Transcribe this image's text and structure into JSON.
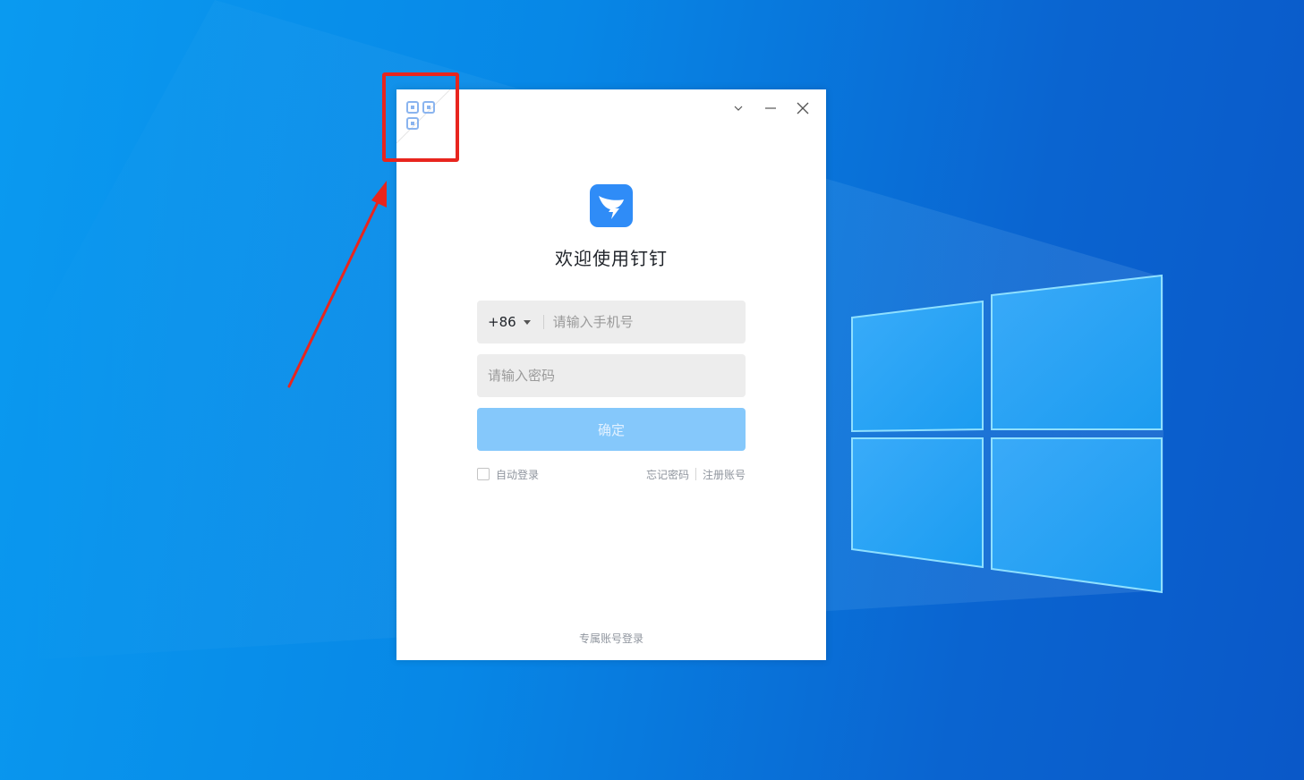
{
  "login": {
    "welcome_title": "欢迎使用钉钉",
    "country_code": "+86",
    "phone_placeholder": "请输入手机号",
    "password_placeholder": "请输入密码",
    "confirm_label": "确定",
    "auto_login_label": "自动登录",
    "forgot_password_label": "忘记密码",
    "register_label": "注册账号",
    "exclusive_login_label": "专属账号登录"
  },
  "icons": {
    "qr_switch": "qr-code-icon",
    "dropdown": "chevron-down-icon",
    "minimize": "minimize-icon",
    "close": "close-icon",
    "logo": "dingtalk-logo-icon"
  },
  "colors": {
    "desktop_background": "#0787e6",
    "confirm_button_disabled": "#85c8fb",
    "input_background": "#ededed",
    "logo_blue": "#2f8cf7",
    "annotation_red": "#e8251e"
  }
}
